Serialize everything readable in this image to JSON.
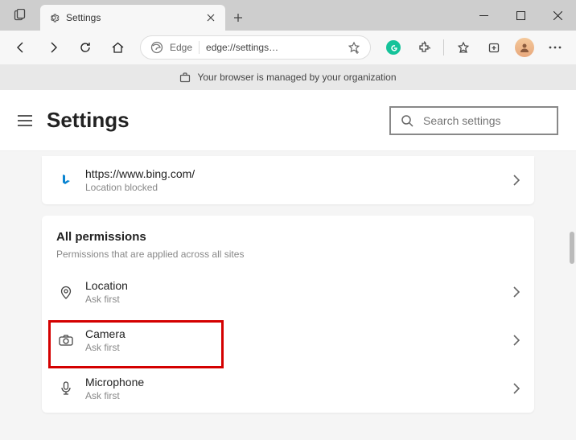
{
  "window": {
    "tab_title": "Settings",
    "address_label": "Edge",
    "address_url": "edge://settings…"
  },
  "orgbar": {
    "message": "Your browser is managed by your organization"
  },
  "header": {
    "title": "Settings",
    "search_placeholder": "Search settings"
  },
  "recent": {
    "url": "https://www.bing.com/",
    "status": "Location blocked"
  },
  "section": {
    "title": "All permissions",
    "subtitle": "Permissions that are applied across all sites"
  },
  "perms": [
    {
      "name": "Location",
      "status": "Ask first"
    },
    {
      "name": "Camera",
      "status": "Ask first"
    },
    {
      "name": "Microphone",
      "status": "Ask first"
    }
  ]
}
